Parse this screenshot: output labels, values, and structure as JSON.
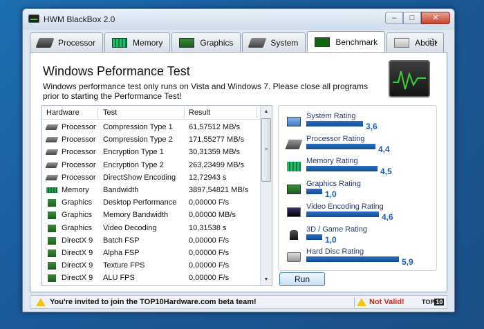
{
  "window": {
    "title": "HWM BlackBox 2.0"
  },
  "tabs": [
    {
      "label": "Processor",
      "icon": "processor-icon"
    },
    {
      "label": "Memory",
      "icon": "memory-icon"
    },
    {
      "label": "Graphics",
      "icon": "graphics-icon"
    },
    {
      "label": "System",
      "icon": "system-icon"
    },
    {
      "label": "Benchmark",
      "icon": "benchmark-icon",
      "active": true
    },
    {
      "label": "About",
      "icon": "about-icon"
    }
  ],
  "page": {
    "title": "Windows Peformance Test",
    "description": "Windows performance test only runs on Vista and Windows 7. Please close all programs prior to starting the Performance Test!"
  },
  "table": {
    "columns": [
      "Hardware",
      "Test",
      "Result"
    ],
    "rows": [
      {
        "hardware": "Processor",
        "test": "Compression Type 1",
        "result": "61,57512 MB/s",
        "icon": "processor-icon"
      },
      {
        "hardware": "Processor",
        "test": "Compression Type 2",
        "result": "171,55277 MB/s",
        "icon": "processor-icon"
      },
      {
        "hardware": "Processor",
        "test": "Encryption Type 1",
        "result": "30,31359 MB/s",
        "icon": "processor-icon"
      },
      {
        "hardware": "Processor",
        "test": "Encryption Type 2",
        "result": "263,23499 MB/s",
        "icon": "processor-icon"
      },
      {
        "hardware": "Processor",
        "test": "DirectShow Encoding",
        "result": "12,72943 s",
        "icon": "processor-icon"
      },
      {
        "hardware": "Memory",
        "test": "Bandwidth",
        "result": "3897,54821 MB/s",
        "icon": "memory-icon"
      },
      {
        "hardware": "Graphics",
        "test": "Desktop Performance",
        "result": "0,00000 F/s",
        "icon": "graphics-icon"
      },
      {
        "hardware": "Graphics",
        "test": "Memory Bandwidth",
        "result": "0,00000 MB/s",
        "icon": "graphics-icon"
      },
      {
        "hardware": "Graphics",
        "test": "Video Decoding",
        "result": "10,31538 s",
        "icon": "graphics-icon"
      },
      {
        "hardware": "DirectX 9",
        "test": "Batch FSP",
        "result": "0,00000 F/s",
        "icon": "graphics-icon"
      },
      {
        "hardware": "DirectX 9",
        "test": "Alpha FSP",
        "result": "0,00000 F/s",
        "icon": "graphics-icon"
      },
      {
        "hardware": "DirectX 9",
        "test": "Texture FPS",
        "result": "0,00000 F/s",
        "icon": "graphics-icon"
      },
      {
        "hardware": "DirectX 9",
        "test": "ALU FPS",
        "result": "0,00000 F/s",
        "icon": "graphics-icon"
      }
    ]
  },
  "ratings": {
    "max": 7.9,
    "items": [
      {
        "label": "System Rating",
        "value": "3,6",
        "score": 3.6,
        "icon": "system-rating-icon"
      },
      {
        "label": "Processor Rating",
        "value": "4,4",
        "score": 4.4,
        "icon": "processor-rating-icon"
      },
      {
        "label": "Memory Rating",
        "value": "4,5",
        "score": 4.5,
        "icon": "memory-rating-icon"
      },
      {
        "label": "Graphics Rating",
        "value": "1,0",
        "score": 1.0,
        "icon": "graphics-rating-icon"
      },
      {
        "label": "Video Encoding Rating",
        "value": "4,6",
        "score": 4.6,
        "icon": "video-rating-icon"
      },
      {
        "label": "3D / Game Rating",
        "value": "1,0",
        "score": 1.0,
        "icon": "game-rating-icon"
      },
      {
        "label": "Hard Disc Rating",
        "value": "5,9",
        "score": 5.9,
        "icon": "hard-disc-rating-icon"
      }
    ]
  },
  "buttons": {
    "run": "Run"
  },
  "status": {
    "left": "You're invited to join the TOP10Hardware.com beta team!",
    "right": "Not Valid!",
    "logo_a": "TOP",
    "logo_b": "10"
  },
  "colors": {
    "accent": "#1b60b8",
    "bar": "#1b5aa8",
    "invalid": "#d02a16"
  }
}
